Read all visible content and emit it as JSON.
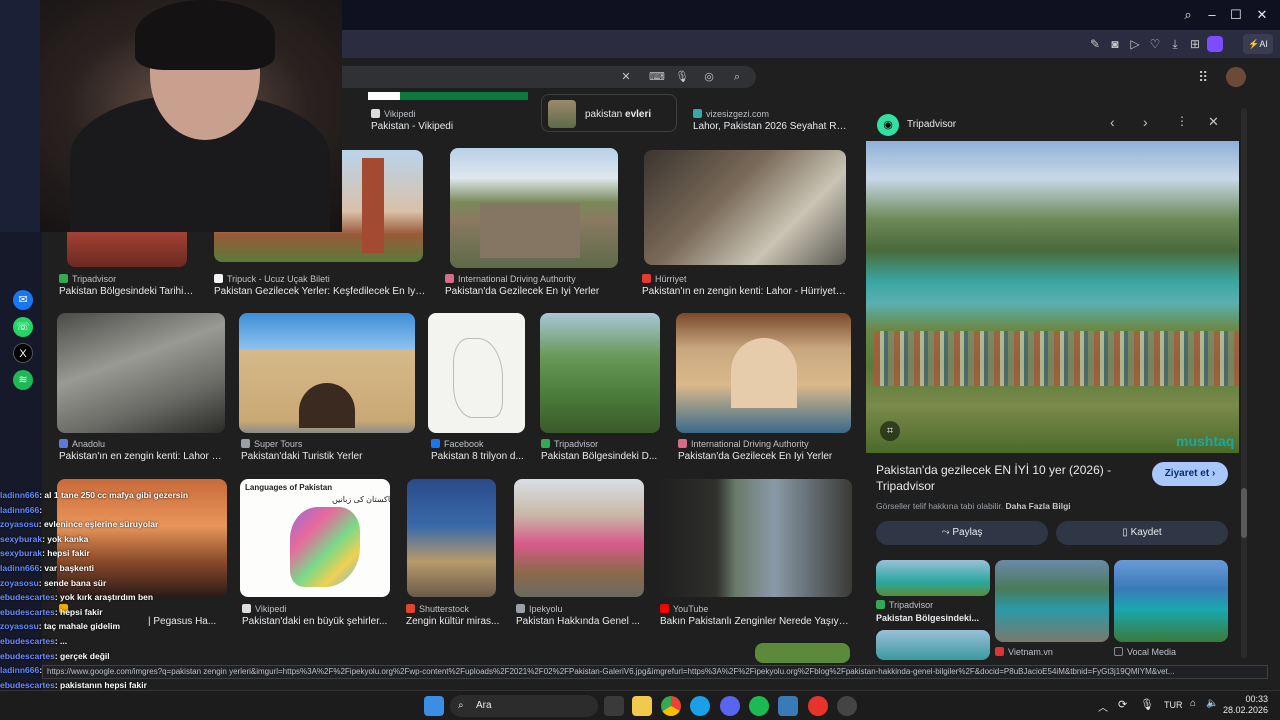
{
  "search": {
    "placeholder": ""
  },
  "top_row": {
    "wiki_source": "Vikipedi",
    "wiki_title": "Pakistan - Vikipedi",
    "chip_label_prefix": "pakistan ",
    "chip_label_bold": "evleri",
    "viz_source": "vizesizgezi.com",
    "viz_title": "Lahor, Pakistan 2026 Seyahat Re..."
  },
  "row1": [
    {
      "source": "Tripadvisor",
      "title": "Pakistan Bölgesindeki Tarihi ...",
      "fav": "#34a853"
    },
    {
      "source": "Tripuck - Ucuz Uçak Bileti",
      "title": "Pakistan Gezilecek Yerler: Keşfedilecek En İyi ...",
      "fav": "#f4f4f4"
    },
    {
      "source": "International Driving Authority",
      "title": "Pakistan'da Gezilecek En İyi Yerler",
      "fav": "#d76b8a"
    },
    {
      "source": "Hürriyet",
      "title": "Pakistan'ın en zengin kenti: Lahor - Hürriyet S...",
      "fav": "#e53935"
    }
  ],
  "row2": [
    {
      "source": "Anadolu",
      "title": "Pakistan'ın en zengin kenti: Lahor - ...",
      "fav": "#5b7bd5"
    },
    {
      "source": "Super Tours",
      "title": "Pakistan'daki Turistik Yerler",
      "fav": "#9aa0a6"
    },
    {
      "source": "Facebook",
      "title": "Pakistan 8 trilyon d...",
      "fav": "#1877f2"
    },
    {
      "source": "Tripadvisor",
      "title": "Pakistan Bölgesindeki D...",
      "fav": "#34a853"
    },
    {
      "source": "International Driving Authority",
      "title": "Pakistan'da Gezilecek En İyi Yerler",
      "fav": "#d76b8a"
    }
  ],
  "row3": [
    {
      "source": "",
      "title": "| Pegasus Ha...",
      "fav": "#f2a900"
    },
    {
      "source": "Vikipedi",
      "title": "Pakistan'daki en büyük şehirler...",
      "fav": "#dddddd"
    },
    {
      "source": "Shutterstock",
      "title": "Zengin kültür miras...",
      "fav": "#e0442f"
    },
    {
      "source": "Ipekyolu",
      "title": "Pakistan Hakkında Genel ...",
      "fav": "#9aa0a6"
    },
    {
      "source": "YouTube",
      "title": "Bakın Pakistanlı Zenginler Nerede Yaşıyo...",
      "fav": "#ff0000"
    }
  ],
  "map_title": "Languages of Pakistan",
  "map_urdu": "پاکستان کی زبانیں",
  "panel": {
    "source": "Tripadvisor",
    "title": "Pakistan'da gezilecek EN İYİ 10 yer (2026) - Tripadvisor",
    "visit_button": "Ziyaret et",
    "notice": "Görseller telif hakkına tabi olabilir.",
    "notice_link": "Daha Fazla Bilgi",
    "share_button": "Paylaş",
    "save_button": "Kaydet",
    "watermark": "mushtaq",
    "related": [
      {
        "source": "Tripadvisor",
        "title": "Pakistan Bölgesindeki..."
      },
      {
        "source": "Vietnam.vn",
        "title": ""
      },
      {
        "source": "Vocal Media",
        "title": ""
      }
    ]
  },
  "chat": [
    {
      "user": "ladinn666",
      "msg": ": al 1 tane 250 cc mafya gibi gezersin",
      "cls": "u1"
    },
    {
      "user": "ladinn666",
      "msg": ":",
      "cls": "u1"
    },
    {
      "user": "zoyasosu",
      "msg": ": evlenince eşlerine süruyolar",
      "cls": "u1"
    },
    {
      "user": "sexyburak",
      "msg": ": yok kanka",
      "cls": "u2"
    },
    {
      "user": "sexyburak",
      "msg": ": hepsi fakir",
      "cls": "u2"
    },
    {
      "user": "ladinn666",
      "msg": ": var başkenti",
      "cls": "u1"
    },
    {
      "user": "zoyasosu",
      "msg": ": sende bana sür",
      "cls": "u1"
    },
    {
      "user": "ebudescartes",
      "msg": ": yok kırk araştırdım ben",
      "cls": "u2"
    },
    {
      "user": "ebudescartes",
      "msg": ": hepsi fakir",
      "cls": "u2"
    },
    {
      "user": "zoyasosu",
      "msg": ": taç mahale gidelim",
      "cls": "u1"
    },
    {
      "user": "ebudescartes",
      "msg": ": ...",
      "cls": "u2"
    },
    {
      "user": "ebudescartes",
      "msg": ": gerçek değil",
      "cls": "u2"
    },
    {
      "user": "ladinn666",
      "msg": ":",
      "cls": "u1"
    },
    {
      "user": "ebudescartes",
      "msg": ": pakistanın hepsi fakir",
      "cls": "u2"
    }
  ],
  "status_url": "https://www.google.com/imgres?q=pakistan zengin yerleri&imgurl=https%3A%2F%2Fipekyolu.org%2Fwp-content%2Fuploads%2F2021%2F02%2FPakistan-GaleriV6.jpg&imgrefurl=https%3A%2F%2Fipekyolu.org%2Fblog%2Fpakistan-hakkinda-genel-bilgiler%2F&docid=P8uBJacioE54iM&tbnid=FyGt3j19QMIYM&vet...",
  "taskbar": {
    "search_label": "Ara",
    "lang": "TUR",
    "time": "00:33",
    "date": "28.02.2026"
  },
  "colors": {
    "accent": "#8ab4f8",
    "panel_bg": "#1f1f1f",
    "visit_btn": "#a8c7fa",
    "pill": "#2f3747"
  }
}
